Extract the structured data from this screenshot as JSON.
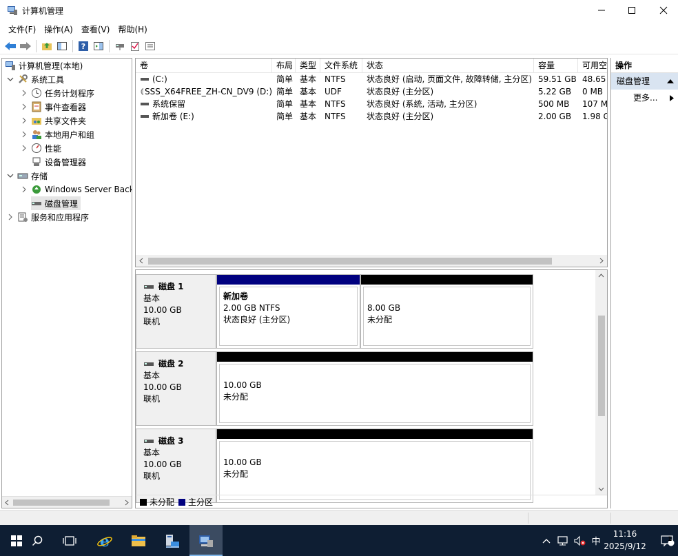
{
  "window": {
    "title": "计算机管理"
  },
  "menu": [
    "文件(F)",
    "操作(A)",
    "查看(V)",
    "帮助(H)"
  ],
  "tree": {
    "root": "计算机管理(本地)",
    "system_tools": "系统工具",
    "task_scheduler": "任务计划程序",
    "event_viewer": "事件查看器",
    "shared_folders": "共享文件夹",
    "local_users": "本地用户和组",
    "performance": "性能",
    "device_manager": "设备管理器",
    "storage": "存储",
    "windows_backup": "Windows Server Backup",
    "disk_management": "磁盘管理",
    "services_apps": "服务和应用程序"
  },
  "volumes": {
    "columns": [
      "卷",
      "布局",
      "类型",
      "文件系统",
      "状态",
      "容量",
      "可用空"
    ],
    "rows": [
      [
        "(C:)",
        "简单",
        "基本",
        "NTFS",
        "状态良好 (启动, 页面文件, 故障转储, 主分区)",
        "59.51 GB",
        "48.65"
      ],
      [
        "SSS_X64FREE_ZH-CN_DV9 (D:)",
        "简单",
        "基本",
        "UDF",
        "状态良好 (主分区)",
        "5.22 GB",
        "0 MB"
      ],
      [
        "系统保留",
        "简单",
        "基本",
        "NTFS",
        "状态良好 (系统, 活动, 主分区)",
        "500 MB",
        "107 M"
      ],
      [
        "新加卷 (E:)",
        "简单",
        "基本",
        "NTFS",
        "状态良好 (主分区)",
        "2.00 GB",
        "1.98 G"
      ]
    ]
  },
  "actions": {
    "header": "操作",
    "section": "磁盘管理",
    "more": "更多..."
  },
  "disks": [
    {
      "name": "磁盘 1",
      "type": "基本",
      "size": "10.00 GB",
      "status": "联机",
      "partitions": [
        {
          "label": "新加卷",
          "line1": "2.00 GB NTFS",
          "line2": "状态良好 (主分区)",
          "kind": "primary"
        },
        {
          "label": "",
          "line1": "8.00 GB",
          "line2": "未分配",
          "kind": "unallocated"
        }
      ]
    },
    {
      "name": "磁盘 2",
      "type": "基本",
      "size": "10.00 GB",
      "status": "联机",
      "partitions": [
        {
          "label": "",
          "line1": "10.00 GB",
          "line2": "未分配",
          "kind": "unallocated"
        }
      ]
    },
    {
      "name": "磁盘 3",
      "type": "基本",
      "size": "10.00 GB",
      "status": "联机",
      "partitions": [
        {
          "label": "",
          "line1": "10.00 GB",
          "line2": "未分配",
          "kind": "unallocated"
        }
      ]
    }
  ],
  "legend": {
    "unallocated": "未分配",
    "primary": "主分区"
  },
  "colors": {
    "primary": "#00007f",
    "unallocated": "#000000",
    "taskbar": "#0e1e33",
    "accent": "#d9e4f1"
  },
  "taskbar": {
    "time": "11:16",
    "date": "2025/9/12",
    "ime": "中",
    "notifications": "1"
  }
}
